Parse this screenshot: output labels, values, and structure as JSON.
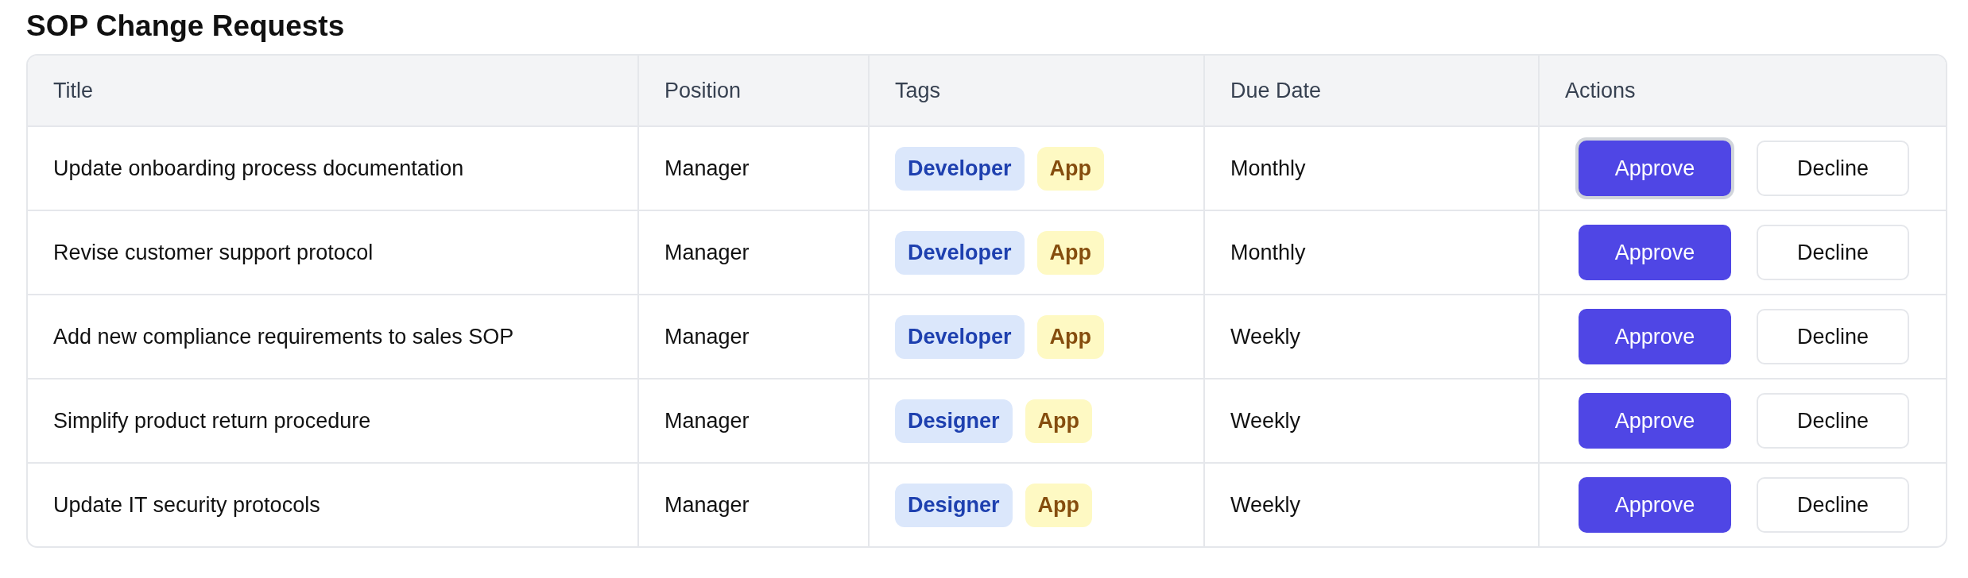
{
  "title": "SOP Change Requests",
  "table": {
    "columns": [
      "Title",
      "Position",
      "Tags",
      "Due Date",
      "Actions"
    ],
    "rows": [
      {
        "title": "Update onboarding process documentation",
        "position": "Manager",
        "tags": [
          {
            "label": "Developer",
            "kind": "role"
          },
          {
            "label": "App",
            "kind": "platform"
          }
        ],
        "due_date": "Monthly",
        "actions": [
          {
            "label": "Approve",
            "kind": "primary",
            "focused": true
          },
          {
            "label": "Decline",
            "kind": "secondary",
            "focused": false
          }
        ]
      },
      {
        "title": "Revise customer support protocol",
        "position": "Manager",
        "tags": [
          {
            "label": "Developer",
            "kind": "role"
          },
          {
            "label": "App",
            "kind": "platform"
          }
        ],
        "due_date": "Monthly",
        "actions": [
          {
            "label": "Approve",
            "kind": "primary",
            "focused": false
          },
          {
            "label": "Decline",
            "kind": "secondary",
            "focused": false
          }
        ]
      },
      {
        "title": "Add new compliance requirements to sales SOP",
        "position": "Manager",
        "tags": [
          {
            "label": "Developer",
            "kind": "role"
          },
          {
            "label": "App",
            "kind": "platform"
          }
        ],
        "due_date": "Weekly",
        "actions": [
          {
            "label": "Approve",
            "kind": "primary",
            "focused": false
          },
          {
            "label": "Decline",
            "kind": "secondary",
            "focused": false
          }
        ]
      },
      {
        "title": "Simplify product return procedure",
        "position": "Manager",
        "tags": [
          {
            "label": "Designer",
            "kind": "role"
          },
          {
            "label": "App",
            "kind": "platform"
          }
        ],
        "due_date": "Weekly",
        "actions": [
          {
            "label": "Approve",
            "kind": "primary",
            "focused": false
          },
          {
            "label": "Decline",
            "kind": "secondary",
            "focused": false
          }
        ]
      },
      {
        "title": "Update IT security protocols",
        "position": "Manager",
        "tags": [
          {
            "label": "Designer",
            "kind": "role"
          },
          {
            "label": "App",
            "kind": "platform"
          }
        ],
        "due_date": "Weekly",
        "actions": [
          {
            "label": "Approve",
            "kind": "primary",
            "focused": false
          },
          {
            "label": "Decline",
            "kind": "secondary",
            "focused": false
          }
        ]
      }
    ]
  }
}
